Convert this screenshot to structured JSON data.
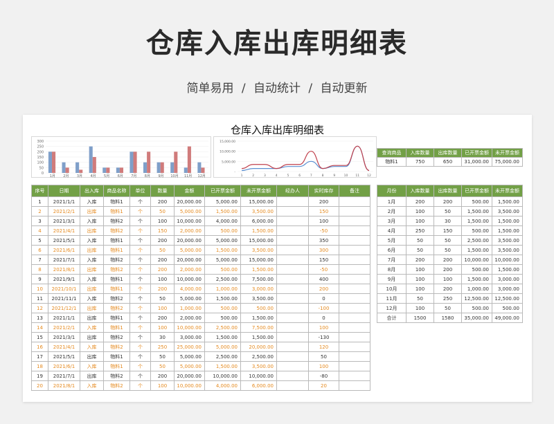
{
  "hero": {
    "title": "仓库入库出库明细表",
    "subtitle": "简单易用  /  自动统计  /  自动更新"
  },
  "sheet": {
    "title": "仓库入库出库明细表"
  },
  "colors": {
    "header_green": "#72a046",
    "orange_text": "#e58a1f",
    "bar_blue": "#7f9fc9",
    "bar_red": "#d07b7b",
    "line_blue": "#5a8fd1",
    "line_red": "#c0404c"
  },
  "chart_data": [
    {
      "type": "bar",
      "categories": [
        "1月",
        "2月",
        "3月",
        "4月",
        "5月",
        "6月",
        "7月",
        "8月",
        "9月",
        "10月",
        "11月",
        "12月"
      ],
      "series": [
        {
          "values": [
            200,
            100,
            100,
            250,
            50,
            50,
            200,
            100,
            100,
            100,
            50,
            100
          ]
        },
        {
          "values": [
            200,
            50,
            30,
            150,
            50,
            50,
            200,
            200,
            100,
            200,
            250,
            50
          ]
        }
      ],
      "ylim": [
        0,
        300
      ],
      "yticks": [
        "0",
        "50",
        "100",
        "150",
        "200",
        "250",
        "300"
      ]
    },
    {
      "type": "line",
      "x": [
        1,
        2,
        3,
        4,
        5,
        6,
        7,
        8,
        9,
        10,
        11,
        12
      ],
      "series": [
        {
          "values": [
            500,
            1500,
            1500,
            1500,
            2500,
            2500,
            5000,
            1500,
            2500,
            2500,
            12500,
            500
          ]
        },
        {
          "values": [
            1500,
            3500,
            3500,
            1500,
            3500,
            3500,
            10000,
            1500,
            3000,
            3000,
            12500,
            500
          ]
        }
      ],
      "ylim": [
        0,
        15000
      ],
      "yticks": [
        "-",
        "5,000.00",
        "10,000.00",
        "15,000.00"
      ],
      "xticks": [
        "1",
        "2",
        "3",
        "4",
        "5",
        "6",
        "7",
        "8",
        "9",
        "10",
        "11",
        "12"
      ]
    }
  ],
  "query": {
    "headers": [
      "查询商品",
      "入库数量",
      "出库数量",
      "已开票金额",
      "未开票金额"
    ],
    "row": [
      "物料1",
      "750",
      "650",
      "31,000.00",
      "75,000.00"
    ]
  },
  "main": {
    "headers": [
      "序号",
      "日期",
      "出入库",
      "商品名称",
      "单位",
      "数量",
      "金额",
      "已开票金额",
      "未开票金额",
      "经办人",
      "实时库存",
      "备注"
    ],
    "rows": [
      [
        "1",
        "2021/1/1",
        "入库",
        "物料1",
        "个",
        "200",
        "20,000.00",
        "5,000.00",
        "15,000.00",
        "",
        "200",
        ""
      ],
      [
        "2",
        "2021/2/1",
        "出库",
        "物料1",
        "个",
        "50",
        "5,000.00",
        "1,500.00",
        "3,500.00",
        "",
        "150",
        ""
      ],
      [
        "3",
        "2021/3/1",
        "入库",
        "物料2",
        "个",
        "100",
        "10,000.00",
        "4,000.00",
        "6,000.00",
        "",
        "100",
        ""
      ],
      [
        "4",
        "2021/4/1",
        "出库",
        "物料2",
        "个",
        "150",
        "2,000.00",
        "500.00",
        "1,500.00",
        "",
        "-50",
        ""
      ],
      [
        "5",
        "2021/5/1",
        "入库",
        "物料1",
        "个",
        "200",
        "20,000.00",
        "5,000.00",
        "15,000.00",
        "",
        "350",
        ""
      ],
      [
        "6",
        "2021/6/1",
        "出库",
        "物料1",
        "个",
        "50",
        "5,000.00",
        "1,500.00",
        "3,500.00",
        "",
        "300",
        ""
      ],
      [
        "7",
        "2021/7/1",
        "入库",
        "物料2",
        "个",
        "200",
        "20,000.00",
        "5,000.00",
        "15,000.00",
        "",
        "150",
        ""
      ],
      [
        "8",
        "2021/8/1",
        "出库",
        "物料2",
        "个",
        "200",
        "2,000.00",
        "500.00",
        "1,500.00",
        "",
        "-50",
        ""
      ],
      [
        "9",
        "2021/9/1",
        "入库",
        "物料1",
        "个",
        "100",
        "10,000.00",
        "2,500.00",
        "7,500.00",
        "",
        "400",
        ""
      ],
      [
        "10",
        "2021/10/1",
        "出库",
        "物料1",
        "个",
        "200",
        "4,000.00",
        "1,000.00",
        "3,000.00",
        "",
        "200",
        ""
      ],
      [
        "11",
        "2021/11/1",
        "入库",
        "物料2",
        "个",
        "50",
        "5,000.00",
        "1,500.00",
        "3,500.00",
        "",
        "0",
        ""
      ],
      [
        "12",
        "2021/12/1",
        "出库",
        "物料2",
        "个",
        "100",
        "1,000.00",
        "500.00",
        "500.00",
        "",
        "-100",
        ""
      ],
      [
        "13",
        "2021/1/1",
        "出库",
        "物料1",
        "个",
        "200",
        "2,000.00",
        "500.00",
        "1,500.00",
        "",
        "0",
        ""
      ],
      [
        "14",
        "2021/2/1",
        "入库",
        "物料1",
        "个",
        "100",
        "10,000.00",
        "2,500.00",
        "7,500.00",
        "",
        "100",
        ""
      ],
      [
        "15",
        "2021/3/1",
        "出库",
        "物料2",
        "个",
        "30",
        "3,000.00",
        "1,500.00",
        "1,500.00",
        "",
        "-130",
        ""
      ],
      [
        "16",
        "2021/4/1",
        "入库",
        "物料2",
        "个",
        "250",
        "25,000.00",
        "5,000.00",
        "20,000.00",
        "",
        "120",
        ""
      ],
      [
        "17",
        "2021/5/1",
        "出库",
        "物料1",
        "个",
        "50",
        "5,000.00",
        "2,500.00",
        "2,500.00",
        "",
        "50",
        ""
      ],
      [
        "18",
        "2021/6/1",
        "入库",
        "物料1",
        "个",
        "50",
        "5,000.00",
        "1,500.00",
        "3,500.00",
        "",
        "100",
        ""
      ],
      [
        "19",
        "2021/7/1",
        "出库",
        "物料2",
        "个",
        "200",
        "20,000.00",
        "10,000.00",
        "10,000.00",
        "",
        "-80",
        ""
      ],
      [
        "20",
        "2021/8/1",
        "入库",
        "物料2",
        "个",
        "100",
        "10,000.00",
        "4,000.00",
        "6,000.00",
        "",
        "20",
        ""
      ]
    ]
  },
  "monthly": {
    "headers": [
      "月份",
      "入库数量",
      "出库数量",
      "已开票金额",
      "未开票金额"
    ],
    "rows": [
      [
        "1月",
        "200",
        "200",
        "500.00",
        "1,500.00"
      ],
      [
        "2月",
        "100",
        "50",
        "1,500.00",
        "3,500.00"
      ],
      [
        "3月",
        "100",
        "30",
        "1,500.00",
        "1,500.00"
      ],
      [
        "4月",
        "250",
        "150",
        "500.00",
        "1,500.00"
      ],
      [
        "5月",
        "50",
        "50",
        "2,500.00",
        "3,500.00"
      ],
      [
        "6月",
        "50",
        "50",
        "1,500.00",
        "3,500.00"
      ],
      [
        "7月",
        "200",
        "200",
        "10,000.00",
        "10,000.00"
      ],
      [
        "8月",
        "100",
        "200",
        "500.00",
        "1,500.00"
      ],
      [
        "9月",
        "100",
        "100",
        "1,500.00",
        "3,000.00"
      ],
      [
        "10月",
        "100",
        "200",
        "1,000.00",
        "3,000.00"
      ],
      [
        "11月",
        "50",
        "250",
        "12,500.00",
        "12,500.00"
      ],
      [
        "12月",
        "100",
        "50",
        "500.00",
        "500.00"
      ]
    ],
    "total": [
      "合计",
      "1500",
      "1580",
      "35,000.00",
      "49,000.00"
    ]
  }
}
